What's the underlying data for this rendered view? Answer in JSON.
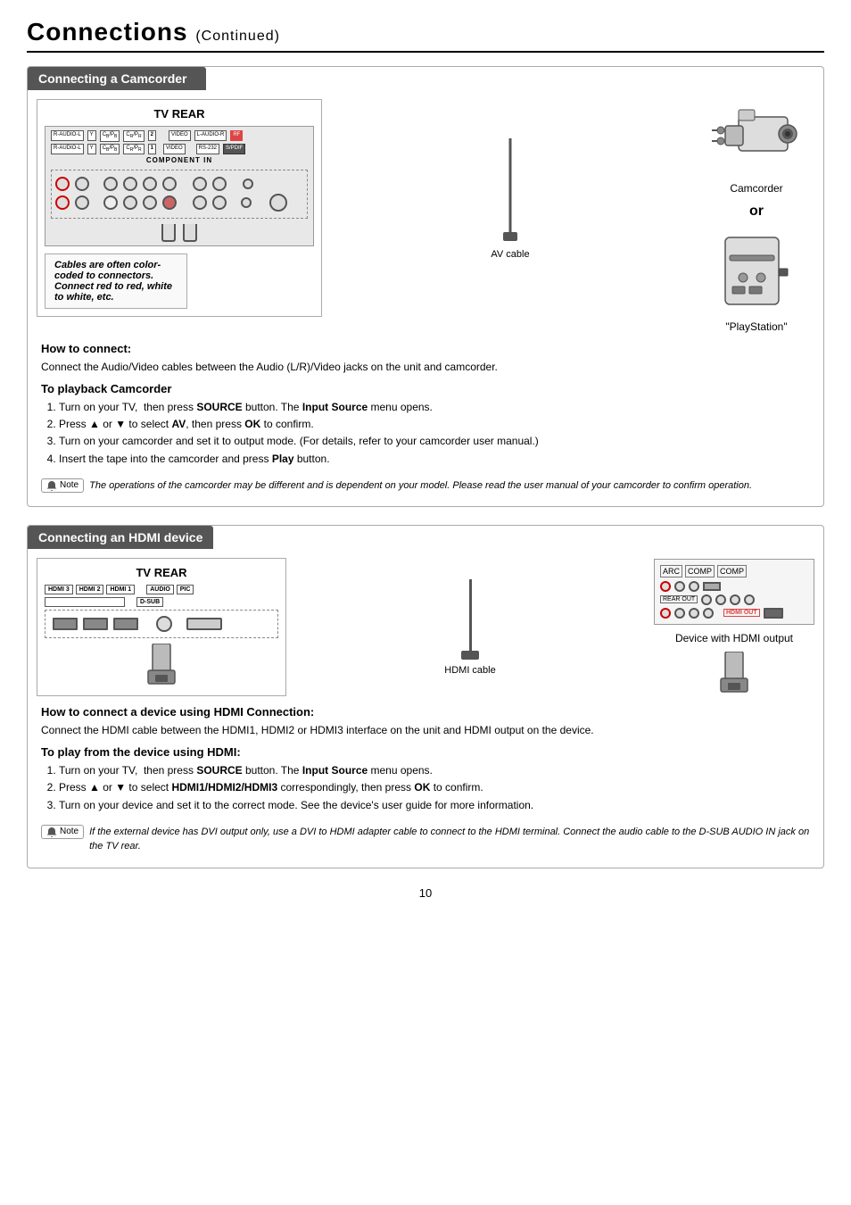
{
  "page": {
    "header_title": "Connections",
    "header_continued": "(Continued)",
    "page_number": "10"
  },
  "section1": {
    "title": "Connecting a Camcorder",
    "tv_rear_label": "TV REAR",
    "cable_note": "Cables are often color-coded to connectors. Connect red to red, white to white, etc.",
    "av_cable_label": "AV cable",
    "camcorder_label": "Camcorder",
    "or_label": "or",
    "playstation_label": "\"PlayStation\"",
    "how_to_connect_heading": "How to connect:",
    "how_to_connect_text": "Connect the Audio/Video cables between the Audio (L/R)/Video jacks on the unit and camcorder.",
    "playback_heading": "To playback Camcorder",
    "playback_steps": [
      "Turn on your TV,  then press SOURCE button. The Input Source menu opens.",
      "Press ▲ or ▼ to select AV, then press OK to confirm.",
      "Turn on your camcorder and set it to output mode. (For details, refer to your camcorder user manual.)",
      "Insert the tape into the camcorder and press Play button."
    ],
    "note_label": "Note",
    "note_text": "The operations of the camcorder may be different and is dependent on your model. Please read the user manual of your camcorder to confirm operation."
  },
  "section2": {
    "title": "Connecting an HDMI device",
    "tv_rear_label": "TV REAR",
    "hdmi_cable_label": "HDMI cable",
    "device_label": "Device with HDMI output",
    "how_to_connect_heading": "How to connect a device using HDMI Connection:",
    "how_to_connect_text": "Connect the HDMI cable between the HDMI1, HDMI2 or HDMI3 interface on the unit and HDMI output on the device.",
    "play_heading": "To play from the device using HDMI:",
    "play_steps": [
      "Turn on your TV,  then press SOURCE button. The Input Source menu opens.",
      "Press ▲ or ▼ to select HDMI1/HDMI2/HDMI3 correspondingly, then press OK to confirm.",
      "Turn on your device and set it to the correct mode. See the device's user guide for more information."
    ],
    "note_label": "Note",
    "note_text": "If the external device has DVI output only, use a DVI to HDMI adapter cable to connect to the HDMI terminal. Connect the audio cable to the D-SUB AUDIO IN jack on the TV rear."
  }
}
